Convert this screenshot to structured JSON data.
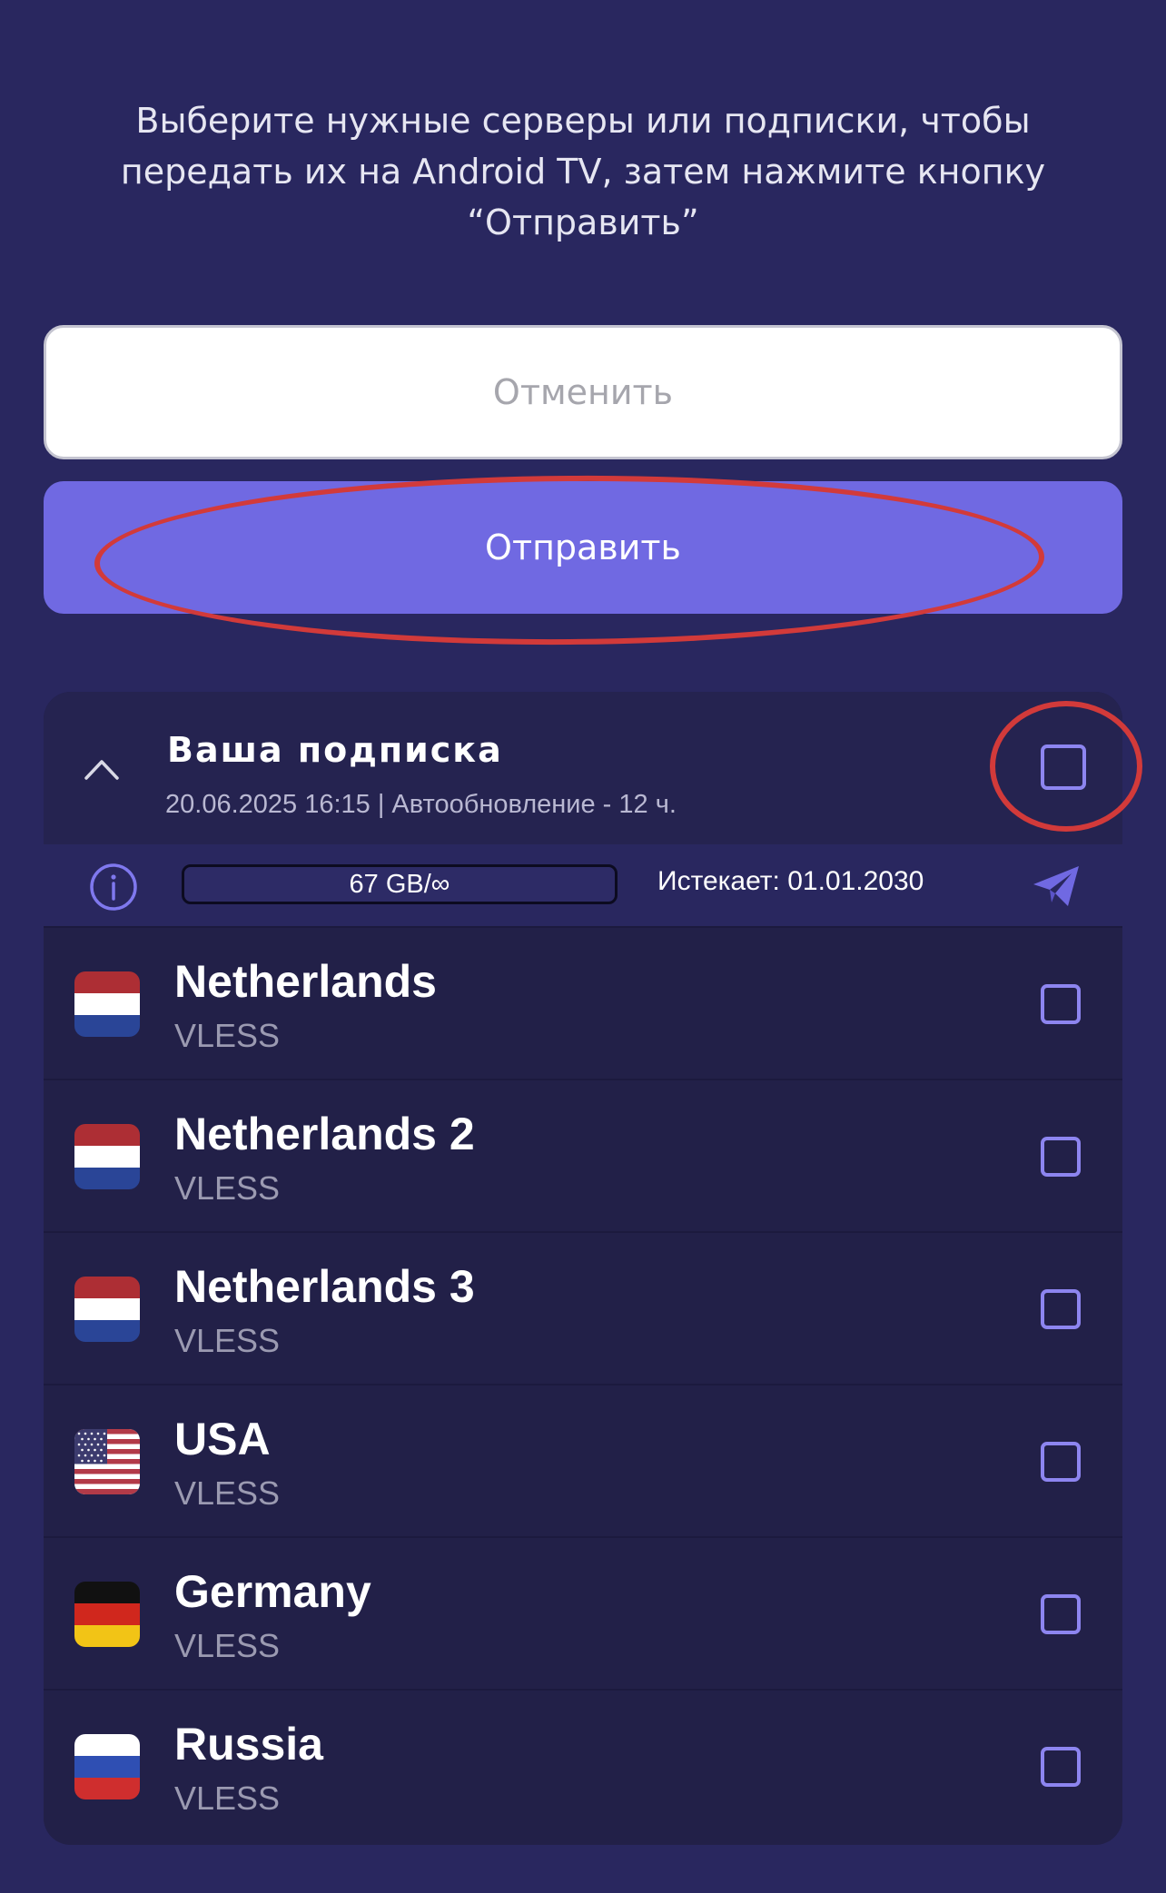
{
  "instructions": "Выберите нужные серверы или подписки, чтобы передать их на Android TV, затем нажмите кнопку “Отправить”",
  "buttons": {
    "cancel_label": "Отменить",
    "send_label": "Отправить"
  },
  "subscription": {
    "title": "Ваша подписка",
    "meta": "20.06.2025 16:15 | Автообновление - 12 ч.",
    "usage": "67 GB/∞",
    "expires": "Истекает: 01.01.2030",
    "checked": false
  },
  "servers": [
    {
      "name": "Netherlands",
      "protocol": "VLESS",
      "flag": "netherlands-flag-icon",
      "checked": false
    },
    {
      "name": "Netherlands 2",
      "protocol": "VLESS",
      "flag": "netherlands-flag-icon",
      "checked": false
    },
    {
      "name": "Netherlands 3",
      "protocol": "VLESS",
      "flag": "netherlands-flag-icon",
      "checked": false
    },
    {
      "name": "USA",
      "protocol": "VLESS",
      "flag": "usa-flag-icon",
      "checked": false
    },
    {
      "name": "Germany",
      "protocol": "VLESS",
      "flag": "germany-flag-icon",
      "checked": false
    },
    {
      "name": "Russia",
      "protocol": "VLESS",
      "flag": "russia-flag-icon",
      "checked": false
    }
  ],
  "colors": {
    "background": "#29275f",
    "card": "#222048",
    "accent": "#7069e2",
    "checkbox": "#8d85f0",
    "annotation": "#d23a3a"
  }
}
